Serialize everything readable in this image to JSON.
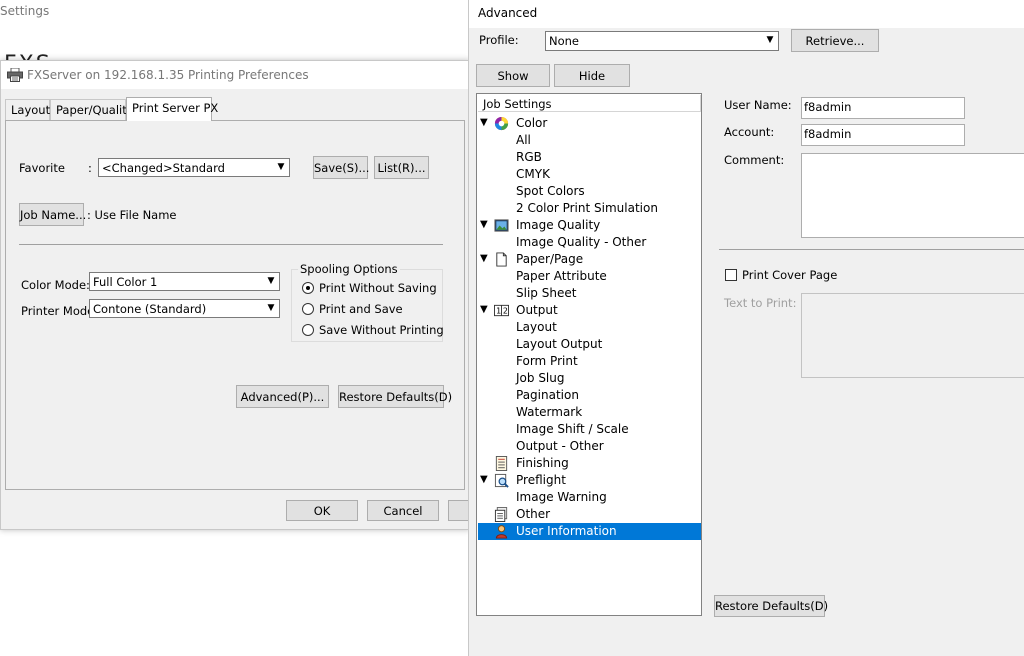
{
  "background": {
    "title": "Settings"
  },
  "prefs": {
    "title": "FXServer on 192.168.1.35 Printing Preferences",
    "tabs": [
      "Layout",
      "Paper/Quality",
      "Print Server PX"
    ],
    "favorite_label": "Favorite",
    "favorite_colon": ":",
    "favorite_value": "<Changed>Standard",
    "save_button": "Save(S)...",
    "list_button": "List(R)...",
    "job_name_button": "Job Name...",
    "job_name_value": ": Use File Name",
    "color_mode_label": "Color Mode:",
    "color_mode_value": "Full Color 1",
    "printer_mode_label": "Printer Mode:",
    "printer_mode_value": "Contone (Standard)",
    "spooling_label": "Spooling Options",
    "spooling_options": [
      {
        "label": "Print Without Saving",
        "selected": true
      },
      {
        "label": "Print and Save",
        "selected": false
      },
      {
        "label": "Save Without Printing",
        "selected": false
      }
    ],
    "advanced_button": "Advanced(P)...",
    "restore_button": "Restore Defaults(D)",
    "ok_button": "OK",
    "cancel_button": "Cancel"
  },
  "advanced": {
    "title": "Advanced",
    "profile_label": "Profile:",
    "profile_value": "None",
    "retrieve_button": "Retrieve...",
    "show_button": "Show",
    "hide_button": "Hide",
    "tree_header": "Job Settings",
    "tree": [
      {
        "label": "Color",
        "level": 0,
        "expanded": true,
        "icon": "color-wheel-icon"
      },
      {
        "label": "All",
        "level": 1
      },
      {
        "label": "RGB",
        "level": 1
      },
      {
        "label": "CMYK",
        "level": 1
      },
      {
        "label": "Spot Colors",
        "level": 1
      },
      {
        "label": "2 Color Print Simulation",
        "level": 1
      },
      {
        "label": "Image Quality",
        "level": 0,
        "expanded": true,
        "icon": "image-icon"
      },
      {
        "label": "Image Quality - Other",
        "level": 1
      },
      {
        "label": "Paper/Page",
        "level": 0,
        "expanded": true,
        "icon": "page-icon"
      },
      {
        "label": "Paper Attribute",
        "level": 1
      },
      {
        "label": "Slip Sheet",
        "level": 1
      },
      {
        "label": "Output",
        "level": 0,
        "expanded": true,
        "icon": "output-icon"
      },
      {
        "label": "Layout",
        "level": 1
      },
      {
        "label": "Layout Output",
        "level": 1
      },
      {
        "label": "Form Print",
        "level": 1
      },
      {
        "label": "Job Slug",
        "level": 1
      },
      {
        "label": "Pagination",
        "level": 1
      },
      {
        "label": "Watermark",
        "level": 1
      },
      {
        "label": "Image Shift / Scale",
        "level": 1
      },
      {
        "label": "Output - Other",
        "level": 1
      },
      {
        "label": "Finishing",
        "level": 0,
        "expanded": false,
        "icon": "finishing-icon"
      },
      {
        "label": "Preflight",
        "level": 0,
        "expanded": true,
        "icon": "preflight-icon"
      },
      {
        "label": "Image Warning",
        "level": 1
      },
      {
        "label": "Other",
        "level": 0,
        "expanded": false,
        "icon": "other-icon"
      },
      {
        "label": "User Information",
        "level": 0,
        "expanded": false,
        "icon": "user-icon",
        "selected": true
      }
    ],
    "user_name_label": "User Name:",
    "user_name_value": "f8admin",
    "account_label": "Account:",
    "account_value": "f8admin",
    "comment_label": "Comment:",
    "comment_value": "",
    "print_cover_label": "Print Cover Page",
    "print_cover_checked": false,
    "text_to_print_label": "Text to Print:",
    "restore_button": "Restore Defaults(D)"
  },
  "colors": {
    "selection": "#0078d7",
    "dialog_bg": "#f0f0f0"
  }
}
